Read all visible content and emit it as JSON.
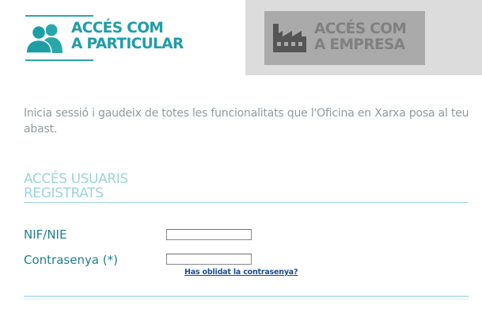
{
  "tabs": {
    "particular": {
      "label_line1": "ACCÉS COM",
      "label_line2": "A PARTICULAR",
      "icon": "people-icon"
    },
    "empresa": {
      "label_line1": "ACCÉS COM",
      "label_line2": "A EMPRESA",
      "icon": "factory-icon"
    }
  },
  "intro_text": "Inicia sessió i gaudeix de totes les funcionalitats que l'Oficina en Xarxa posa al teu abast.",
  "section": {
    "title_line1": "ACCÉS USUARIS",
    "title_line2": "REGISTRATS"
  },
  "form": {
    "nif_label": "NIF/NIE",
    "nif_value": "",
    "password_label": "Contrasenya (*)",
    "password_value": "",
    "forgot_link": "Has oblidat la contrasenya?"
  },
  "colors": {
    "accent": "#1d9ea6",
    "inactive_tab_bg": "#dcdcdc",
    "inactive_tab_inner": "#aaaaaa",
    "intro_text": "#8f9a9e",
    "section_title": "#9ed3d6",
    "link": "#1a4d8f"
  }
}
